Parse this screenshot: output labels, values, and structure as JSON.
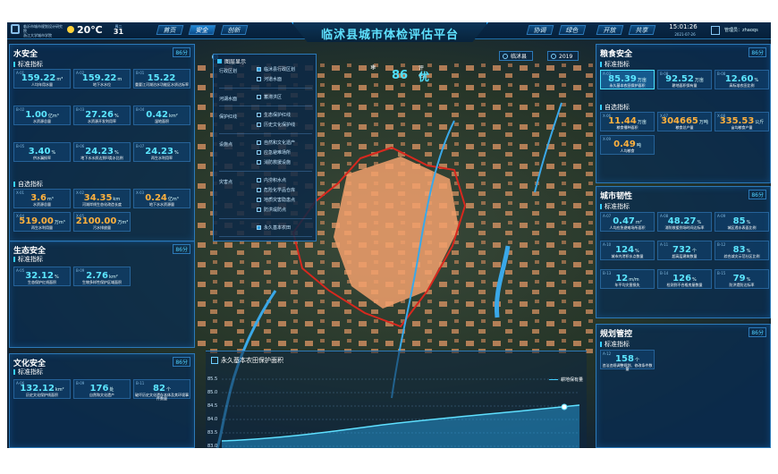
{
  "header": {
    "brand_line1": "临沂市城市规划设计研究院",
    "brand_line2": "浙江大学城市学院",
    "temperature": "20℃",
    "calendar_weekday": "周二",
    "calendar_day": "31",
    "left_nav": [
      "首页",
      "安全",
      "创新"
    ],
    "title": "临沭县城市体检评估平台",
    "right_nav": [
      "协调",
      "绿色",
      "开放",
      "共享"
    ],
    "clock": "15:01:26",
    "date": "2021-07-26",
    "admin_label": "管理员：zhaoqs"
  },
  "controls": {
    "region": "临沭县",
    "year": "2019"
  },
  "weather": {
    "icon_text": "❄",
    "value": "86",
    "level_label": "评估",
    "level_value": "优"
  },
  "layers": {
    "title": "图层显示",
    "groups": [
      {
        "label": "行政区划",
        "items": [
          {
            "label": "临沭县行政区划",
            "checked": true
          },
          {
            "label": "河道水面",
            "checked": false
          }
        ]
      },
      {
        "label": "河湖水面",
        "items": [
          {
            "label": "蓄滞洪区",
            "checked": false
          }
        ]
      },
      {
        "label": "保护红线",
        "items": [
          {
            "label": "生态保护红线",
            "checked": false
          },
          {
            "label": "历史文化保护线",
            "checked": false
          }
        ]
      },
      {
        "label": "设施点",
        "items": [
          {
            "label": "自然和文化遗产",
            "checked": false
          },
          {
            "label": "应急避难场所",
            "checked": false
          },
          {
            "label": "消防救援设施",
            "checked": false
          }
        ]
      },
      {
        "label": "灾害点",
        "items": [
          {
            "label": "内涝积水点",
            "checked": false
          },
          {
            "label": "危险化学品仓库",
            "checked": false
          },
          {
            "label": "地质灾害隐患点",
            "checked": false
          },
          {
            "label": "防洪堤防点",
            "checked": false
          }
        ]
      },
      {
        "label": "",
        "items": [
          {
            "label": "永久基本农田",
            "checked": true
          }
        ]
      }
    ]
  },
  "water": {
    "title": "水安全",
    "btn": "86分",
    "sec1": "标准指标",
    "tiles": [
      {
        "code": "A-01",
        "value": "159.22",
        "unit": "m³",
        "name": "人均年用水量"
      },
      {
        "code": "A-02",
        "value": "159.22",
        "unit": "m",
        "name": "地下水水位"
      },
      {
        "code": "B-01",
        "value": "15.22",
        "unit": "",
        "name": "重要江河湖泊水功能区水质达标率"
      },
      {
        "code": "B-02",
        "value": "1.00",
        "unit": "亿m³",
        "name": "水资源总量"
      },
      {
        "code": "B-03",
        "value": "27.26",
        "unit": "%",
        "name": "水资源开发利用率"
      },
      {
        "code": "B-04",
        "value": "0.42",
        "unit": "km²",
        "name": "湿地面积"
      },
      {
        "code": "B-05",
        "value": "3.40",
        "unit": "%",
        "name": "供水漏损率"
      },
      {
        "code": "B-06",
        "value": "24.23",
        "unit": "%",
        "name": "地下水水质达到III类水比例"
      },
      {
        "code": "B-07",
        "value": "24.23",
        "unit": "%",
        "name": "再生水利用率"
      }
    ],
    "sec2": "自选指标",
    "tiles2": [
      {
        "code": "X-01",
        "value": "3.6",
        "unit": "m³",
        "name": "水资源总量"
      },
      {
        "code": "X-02",
        "value": "34.35",
        "unit": "km",
        "name": "河湖岸线生态化改造长度"
      },
      {
        "code": "X-03",
        "value": "0.24",
        "unit": "亿m³",
        "name": "地下水水资源量"
      },
      {
        "code": "X-04",
        "value": "519.00",
        "unit": "万m³",
        "name": "再生水利用量"
      },
      {
        "code": "X-05",
        "value": "2100.00",
        "unit": "万m³",
        "name": "污水排放量"
      }
    ]
  },
  "eco": {
    "title": "生态安全",
    "btn": "86分",
    "sec1": "标准指标",
    "tiles": [
      {
        "code": "A-05",
        "value": "32.12",
        "unit": "%",
        "name": "生态保护红线面积"
      },
      {
        "code": "B-09",
        "value": "2.76",
        "unit": "km²",
        "name": "生物多样性保护区域面积"
      }
    ]
  },
  "culture": {
    "title": "文化安全",
    "btn": "86分",
    "sec1": "标准指标",
    "tiles": [
      {
        "code": "A-06",
        "value": "132.12",
        "unit": "km²",
        "name": "历史文化保护线面积"
      },
      {
        "code": "B-09",
        "value": "176",
        "unit": "处",
        "name": "自然和文化遗产"
      },
      {
        "code": "B-11",
        "value": "82",
        "unit": "个",
        "name": "破坏历史文化遗存本体及其环境事件数量"
      }
    ]
  },
  "food": {
    "title": "粮食安全",
    "btn": "86分",
    "sec1": "标准指标",
    "tiles": [
      {
        "code": "A-03",
        "value": "85.39",
        "unit": "万亩",
        "name": "永久基本农田保护面积"
      },
      {
        "code": "B-08",
        "value": "92.52",
        "unit": "万亩",
        "name": "耕地面积保有量"
      },
      {
        "code": "B-08",
        "value": "12.60",
        "unit": "%",
        "name": "高标准农田比例"
      }
    ],
    "sec2": "自选指标",
    "tiles2": [
      {
        "code": "X-06",
        "value": "11.44",
        "unit": "万亩",
        "name": "粮食播种面积"
      },
      {
        "code": "X-07",
        "value": "304665",
        "unit": "万吨",
        "name": "粮食总产量"
      },
      {
        "code": "X-08",
        "value": "335.53",
        "unit": "公斤",
        "name": "亩均粮食产量"
      },
      {
        "code": "X-09",
        "value": "0.49",
        "unit": "吨",
        "name": "人均粮食"
      }
    ]
  },
  "resilience": {
    "title": "城市韧性",
    "btn": "86分",
    "sec1": "标准指标",
    "tiles": [
      {
        "code": "A-07",
        "value": "0.47",
        "unit": "m²",
        "name": "人均应急避难场所面积"
      },
      {
        "code": "A-08",
        "value": "48.27",
        "unit": "%",
        "name": "消防救援到场时间达标率"
      },
      {
        "code": "A-09",
        "value": "85",
        "unit": "%",
        "name": "城区透水表面比例"
      },
      {
        "code": "A-10",
        "value": "124",
        "unit": "%",
        "name": "城市内涝积水点数量"
      },
      {
        "code": "A-11",
        "value": "732",
        "unit": "个",
        "name": "超高层建筑数量"
      },
      {
        "code": "B-12",
        "value": "83",
        "unit": "%",
        "name": "综合减灾示范社区比例"
      },
      {
        "code": "B-13",
        "value": "12",
        "unit": "m/m",
        "name": "年平均灾害损失"
      },
      {
        "code": "B-14",
        "value": "126",
        "unit": "%",
        "name": "检测到不合格房屋数量"
      },
      {
        "code": "B-15",
        "value": "79",
        "unit": "%",
        "name": "防洪堤防达标率"
      }
    ]
  },
  "planning": {
    "title": "规划管控",
    "btn": "86分",
    "sec1": "标准指标",
    "tiles": [
      {
        "code": "A-12",
        "value": "158",
        "unit": "个",
        "name": "违法违规调整规划、修改条件数量"
      }
    ]
  },
  "chart_data": {
    "type": "area",
    "title": "永久基本农田保护面积",
    "series": [
      {
        "name": "耕地保有量"
      }
    ],
    "yticks": [
      "85.5",
      "85.0",
      "84.5",
      "84.0",
      "83.5",
      "83.0"
    ]
  }
}
